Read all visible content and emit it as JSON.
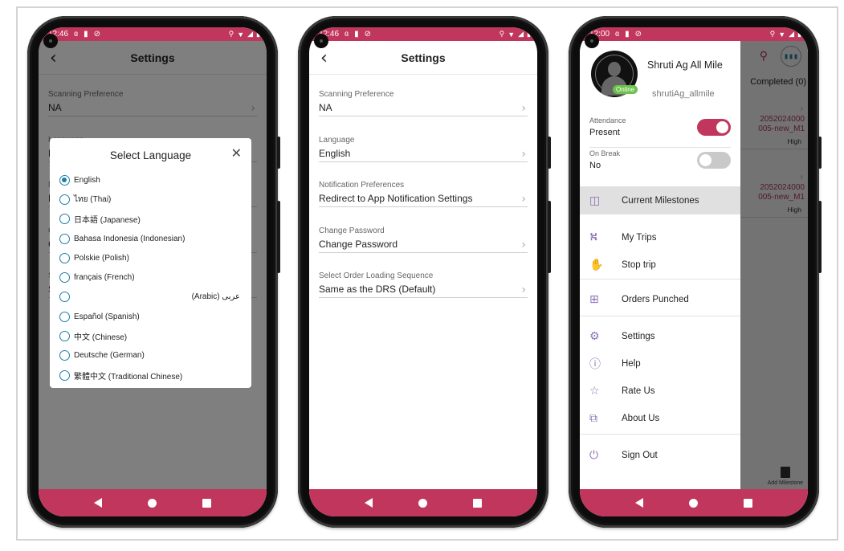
{
  "phone1": {
    "status": {
      "time": "12:46",
      "icons_left": [
        "notification-icon",
        "sd-card-icon",
        "sync-off-icon"
      ],
      "icons_right": [
        "location-icon",
        "wifi-icon",
        "signal-icon",
        "battery-icon"
      ]
    },
    "appbar": {
      "back_icon": "‹",
      "title": "Settings"
    },
    "settings": [
      {
        "label": "Scanning Preference",
        "value": "NA"
      }
    ],
    "dialog": {
      "title": "Select Language",
      "close_icon": "✕",
      "options": [
        {
          "label": "English",
          "selected": true
        },
        {
          "label": "ไทย (Thai)",
          "selected": false
        },
        {
          "label": "日本語 (Japanese)",
          "selected": false
        },
        {
          "label": "Bahasa Indonesia (Indonesian)",
          "selected": false
        },
        {
          "label": "Polskie (Polish)",
          "selected": false
        },
        {
          "label": "français (French)",
          "selected": false
        },
        {
          "label": "عربى (Arabic)",
          "selected": false,
          "rtl": true
        },
        {
          "label": "Español (Spanish)",
          "selected": false
        },
        {
          "label": "中文 (Chinese)",
          "selected": false
        },
        {
          "label": "Deutsche (German)",
          "selected": false
        },
        {
          "label": "繁體中文 (Traditional Chinese)",
          "selected": false
        }
      ]
    }
  },
  "phone2": {
    "status": {
      "time": "12:46"
    },
    "appbar": {
      "back_icon": "‹",
      "title": "Settings"
    },
    "settings": [
      {
        "label": "Scanning Preference",
        "value": "NA"
      },
      {
        "label": "Language",
        "value": "English"
      },
      {
        "label": "Notification Preferences",
        "value": "Redirect to App Notification Settings"
      },
      {
        "label": "Change Password",
        "value": "Change Password"
      },
      {
        "label": "Select Order Loading Sequence",
        "value": "Same as the DRS (Default)"
      }
    ],
    "chevron": "›"
  },
  "phone3": {
    "status": {
      "time": "12:00"
    },
    "background": {
      "search_icon": "⚲",
      "barcode_icon": "▮▮▮",
      "tab": "Completed (0)",
      "cards": [
        {
          "id": "2052024000\n005-new_M1",
          "priority": "High"
        },
        {
          "id": "2052024000\n005-new_M1",
          "priority": "High"
        }
      ],
      "add_milestone": "Add Milestone"
    },
    "drawer": {
      "user_name": "Shruti Ag All Mile",
      "user_handle": "shrutiAg_allmile",
      "online_badge": "Online",
      "attendance": {
        "label": "Attendance",
        "value": "Present",
        "on": true
      },
      "on_break": {
        "label": "On Break",
        "value": "No",
        "on": false
      },
      "menu": [
        {
          "label": "Current Milestones",
          "icon": "milestone-icon",
          "glyph": "◫",
          "active": true
        },
        {
          "label": "My Trips",
          "icon": "trips-icon",
          "glyph": "⛕",
          "active": false
        },
        {
          "label": "Stop trip",
          "icon": "hand-icon",
          "glyph": "✋",
          "active": false
        },
        {
          "label": "Orders Punched",
          "icon": "orders-icon",
          "glyph": "⊞",
          "active": false
        },
        {
          "label": "Settings",
          "icon": "gear-icon",
          "glyph": "⚙",
          "active": false
        },
        {
          "label": "Help",
          "icon": "help-icon",
          "glyph": "ⓘ",
          "active": false
        },
        {
          "label": "Rate Us",
          "icon": "star-icon",
          "glyph": "☆",
          "active": false
        },
        {
          "label": "About Us",
          "icon": "about-icon",
          "glyph": "⧉",
          "active": false
        },
        {
          "label": "Sign Out",
          "icon": "power-icon",
          "glyph": "⏻",
          "active": false
        }
      ]
    }
  },
  "colors": {
    "brand": "#c0365c",
    "radio": "#1d7fa8",
    "online": "#6cc24a",
    "menu_icon": "#8a70b5"
  }
}
